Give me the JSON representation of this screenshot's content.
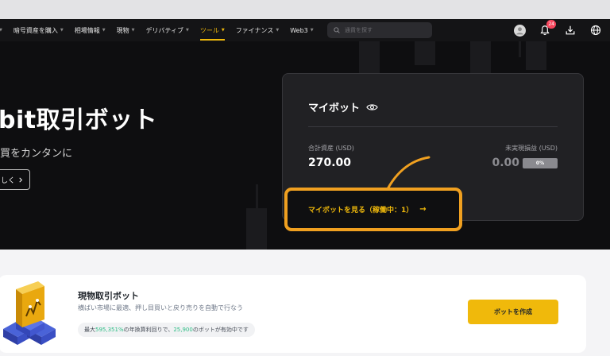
{
  "nav": {
    "items": [
      {
        "label": "",
        "active": false
      },
      {
        "label": "暗号資産を購入",
        "active": false
      },
      {
        "label": "相場情報",
        "active": false
      },
      {
        "label": "現物",
        "active": false
      },
      {
        "label": "デリバティブ",
        "active": false
      },
      {
        "label": "ツール",
        "active": true
      },
      {
        "label": "ファイナンス",
        "active": false
      },
      {
        "label": "Web3",
        "active": false
      }
    ],
    "search_placeholder": "通貨を探す",
    "notification_count": "24"
  },
  "hero": {
    "title": "bit取引ボット",
    "subtitle": "買をカンタンに",
    "button_label": "しく"
  },
  "bot_card": {
    "title": "マイボット",
    "total_label": "合計資産 (USD)",
    "total_value": "270.00",
    "pnl_label": "未実現損益 (USD)",
    "pnl_value": "0.00",
    "pnl_pct": "0%",
    "view_link": "マイボットを見る（稼働中：1）"
  },
  "feature": {
    "title": "現物取引ボット",
    "description": "横ばい市場に最適、押し目買いと戻り売りを自動で行なう",
    "stat_prefix": "最大",
    "stat_pct": "595,351%",
    "stat_mid": "の年換算利回りで、",
    "stat_count": "25,900",
    "stat_suffix": "のボットが有効中です",
    "button_label": "ボットを作成"
  },
  "colors": {
    "accent": "#f0b90b",
    "highlight_border": "#f0a020",
    "positive": "#2ebd85",
    "badge": "#f6465d"
  }
}
